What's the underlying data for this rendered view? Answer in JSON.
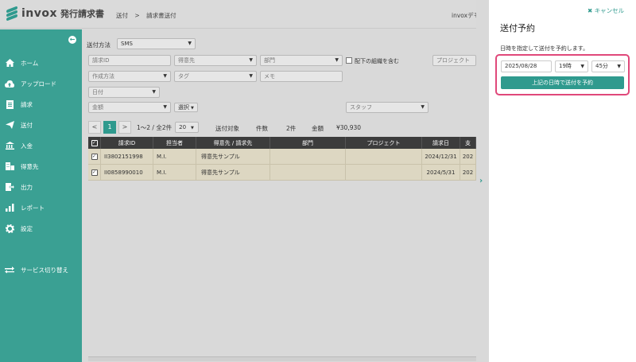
{
  "header": {
    "logo": "invox",
    "logo_sub": "発行請求書",
    "breadcrumb": [
      "送付",
      ">",
      "請求書送付"
    ],
    "user": "invoxデモ"
  },
  "sidebar": {
    "collapse_icon": "arrow-left-circle-icon",
    "items": [
      {
        "label": "ホーム",
        "icon": "home-icon"
      },
      {
        "label": "アップロード",
        "icon": "cloud-upload-icon"
      },
      {
        "label": "請求",
        "icon": "document-icon"
      },
      {
        "label": "送付",
        "icon": "paper-plane-icon"
      },
      {
        "label": "入金",
        "icon": "bank-icon"
      },
      {
        "label": "得意先",
        "icon": "building-icon"
      },
      {
        "label": "出力",
        "icon": "export-icon"
      },
      {
        "label": "レポート",
        "icon": "chart-icon"
      },
      {
        "label": "設定",
        "icon": "gear-icon"
      },
      {
        "label": "サービス切り替え",
        "icon": "switch-icon"
      }
    ]
  },
  "filters": {
    "send_method_label": "送付方法",
    "send_method_value": "SMS",
    "invoice_id": "請求ID",
    "customer": "得意先",
    "department": "部門",
    "include_sub_org": "配下の組織を含む",
    "project": "プロジェクト",
    "creation_method": "作成方法",
    "tag": "タグ",
    "memo": "メモ",
    "date": "日付",
    "amount": "金額",
    "options": "選択",
    "staff": "スタッフ"
  },
  "pager": {
    "prev": "<",
    "page": "1",
    "next": ">",
    "range": "1〜2 / 全2件",
    "per_page": "20"
  },
  "summary": {
    "target_label": "送付対象",
    "count_label": "件数",
    "count_value": "2件",
    "amount_label": "金額",
    "amount_value": "¥30,930"
  },
  "table": {
    "headers": [
      "請求ID",
      "担当者",
      "得意先 / 請求先",
      "部門",
      "プロジェクト",
      "請求日",
      "支"
    ],
    "rows": [
      {
        "id": "II3802151998",
        "staff": "M.I.",
        "customer": "得意先サンプル",
        "department": "",
        "project": "",
        "date": "2024/12/31",
        "extra": "202"
      },
      {
        "id": "II0858990010",
        "staff": "M.I.",
        "customer": "得意先サンプル",
        "department": "",
        "project": "",
        "date": "2024/5/31",
        "extra": "202"
      }
    ]
  },
  "panel": {
    "cancel": "キャンセル",
    "title": "送付予約",
    "description": "日時を指定して送付を予約します。",
    "date": "2025/08/28",
    "hour": "19時",
    "minute": "45分",
    "submit": "上記の日時で送付を予約"
  },
  "colors": {
    "accent": "#2f9a8e",
    "highlight_border": "#e0487a",
    "row_bg": "#ddd7c2"
  }
}
